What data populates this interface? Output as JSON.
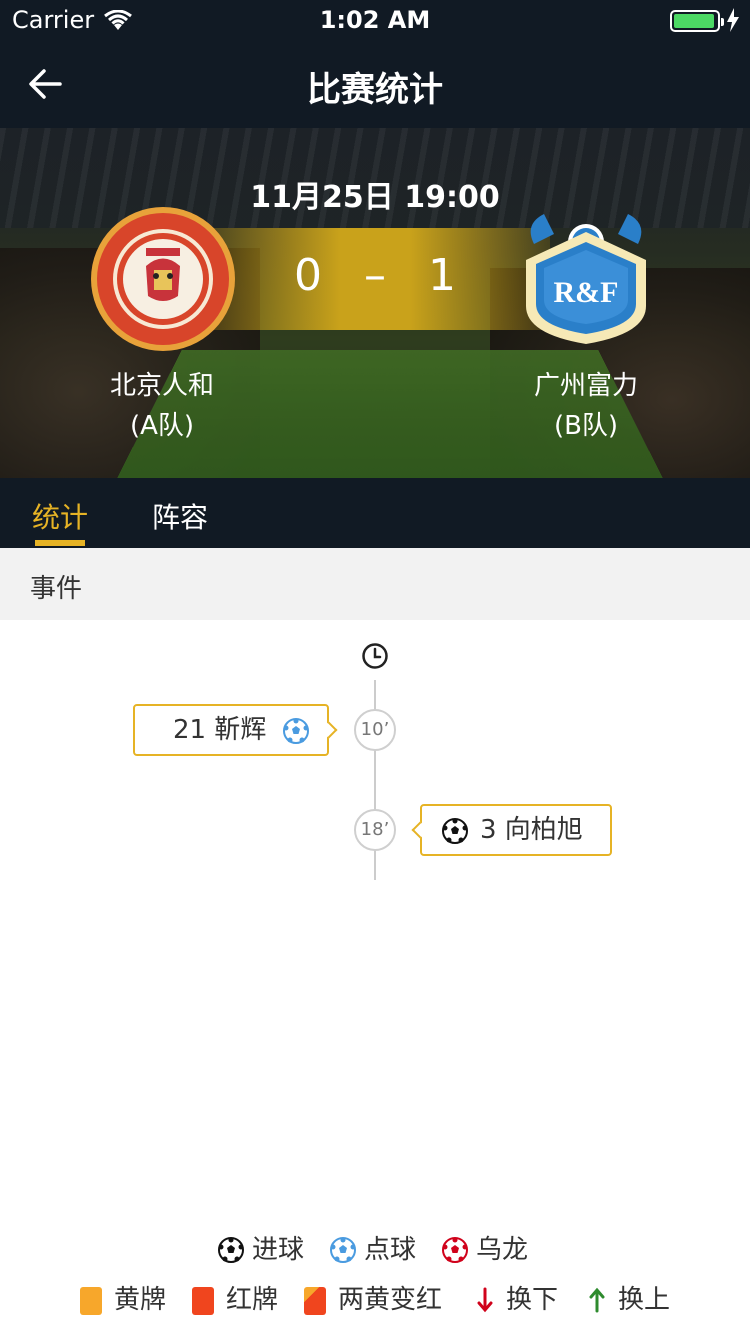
{
  "status_bar": {
    "carrier": "Carrier",
    "time": "1:02 AM",
    "battery_color": "#4cd964"
  },
  "nav": {
    "back_icon": "arrow-left-icon",
    "title": "比赛统计"
  },
  "match": {
    "datetime": "11月25日 19:00",
    "home_score": "0",
    "separator": "–",
    "away_score": "1",
    "home": {
      "name": "北京人和",
      "side": "(A队)",
      "logo": "beijing-renhe-logo"
    },
    "away": {
      "name": "广州富力",
      "side": "(B队)",
      "logo": "guangzhou-rf-logo"
    }
  },
  "tabs": [
    {
      "label": "统计",
      "active": true
    },
    {
      "label": "阵容",
      "active": false
    }
  ],
  "section": {
    "title": "事件"
  },
  "timeline": {
    "events": [
      {
        "minute": "10’",
        "side": "home",
        "text": "21 靳辉",
        "icon": "penalty-ball-icon"
      },
      {
        "minute": "18’",
        "side": "away",
        "text": "3 向柏旭",
        "icon": "goal-ball-icon"
      }
    ]
  },
  "legend": {
    "goal": "进球",
    "penalty": "点球",
    "own_goal": "乌龙",
    "yellow": "黄牌",
    "red": "红牌",
    "second_yellow": "两黄变红",
    "sub_out": "换下",
    "sub_in": "换上"
  },
  "colors": {
    "accent": "#e6b325",
    "header": "#111a24",
    "yellow_card": "#f7a72b",
    "red_card": "#f0451e",
    "sub_out": "#d0021b",
    "sub_in": "#2e8b2e"
  }
}
